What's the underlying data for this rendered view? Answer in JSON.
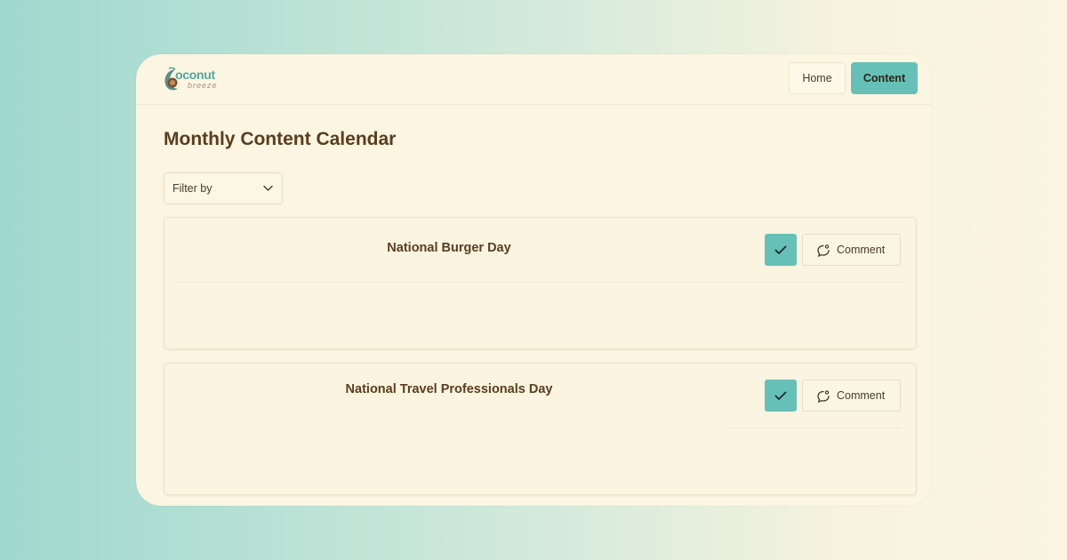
{
  "brand": {
    "name": "oconut",
    "tagline": "breeze"
  },
  "nav": {
    "home_label": "Home",
    "content_label": "Content"
  },
  "page": {
    "title": "Monthly Content Calendar"
  },
  "filter": {
    "label": "Filter by"
  },
  "cards": [
    {
      "title": "National Burger Day",
      "comment_label": "Comment"
    },
    {
      "title": "National Travel Professionals Day",
      "comment_label": "Comment"
    }
  ],
  "colors": {
    "accent": "#67c0b7",
    "text": "#5b3d1f",
    "surface": "#fbf5e1"
  }
}
